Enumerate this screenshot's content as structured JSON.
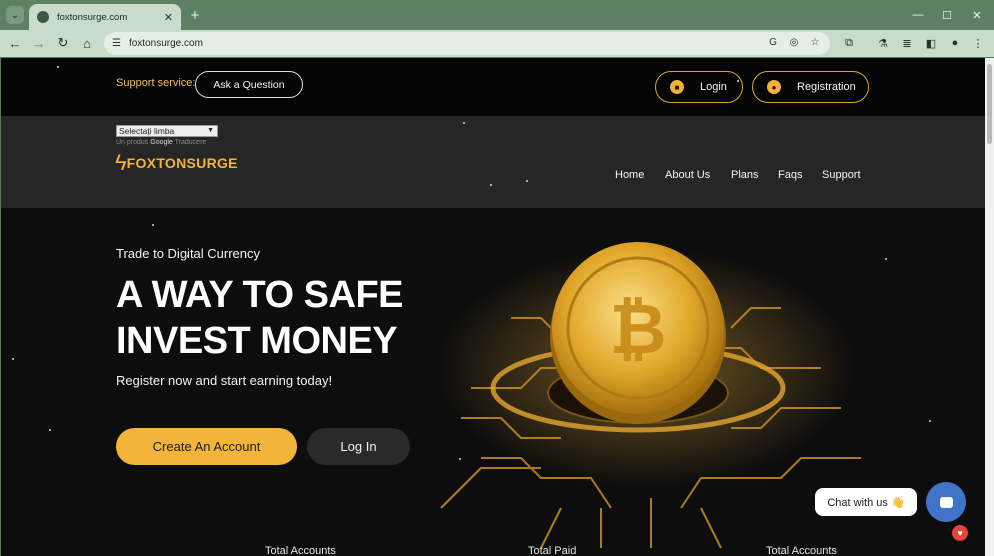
{
  "browser": {
    "tab_title": "foxtonsurge.com",
    "url": "foxtonsurge.com",
    "new_tab_glyph": "+",
    "close_tab_glyph": "✕"
  },
  "topbar": {
    "support_label": "Support service:",
    "ask_button": "Ask a Question",
    "login_button": "Login",
    "registration_button": "Registration"
  },
  "header": {
    "language_select": "Selectați limba",
    "powered_prefix": "Un produs",
    "powered_google": "Google",
    "powered_suffix": "Traducere",
    "logo_text": "FOXTONSURGE",
    "nav": [
      "Home",
      "About Us",
      "Plans",
      "Faqs",
      "Support"
    ]
  },
  "hero": {
    "kicker": "Trade to Digital Currency",
    "title_line1": "A WAY TO SAFE",
    "title_line2": "INVEST MONEY",
    "subtitle": "Register now and start earning today!",
    "create_button": "Create An Account",
    "login_button": "Log In"
  },
  "stats": [
    "Total Accounts",
    "Total Paid",
    "Total Accounts"
  ],
  "chat": {
    "label": "Chat with us 👋"
  },
  "colors": {
    "accent": "#f3b43a",
    "browser_frame": "#5e8064",
    "chat": "#3f74c9"
  }
}
